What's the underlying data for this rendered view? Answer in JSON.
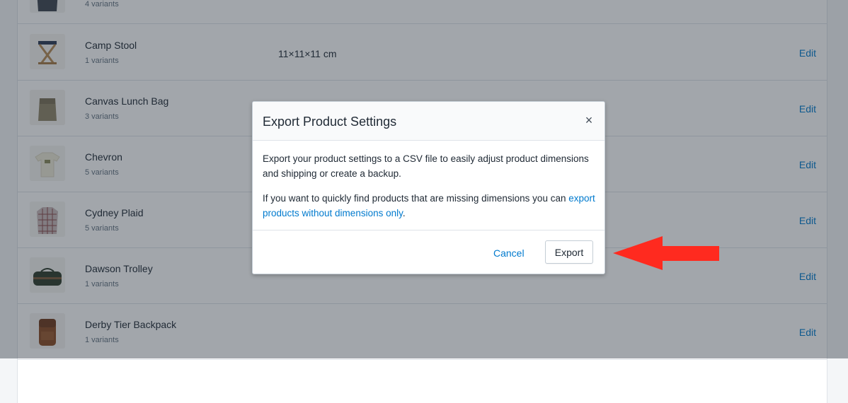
{
  "products": [
    {
      "name": "",
      "variants": "4 variants",
      "dimensions": "",
      "edit_label": "",
      "icon": "jacket-icon"
    },
    {
      "name": "Camp Stool",
      "variants": "1 variants",
      "dimensions": "11×11×11 cm",
      "edit_label": "Edit",
      "icon": "stool-icon"
    },
    {
      "name": "Canvas Lunch Bag",
      "variants": "3 variants",
      "dimensions": "",
      "edit_label": "Edit",
      "icon": "bag-icon"
    },
    {
      "name": "Chevron",
      "variants": "5 variants",
      "dimensions": "",
      "edit_label": "Edit",
      "icon": "tshirt-icon"
    },
    {
      "name": "Cydney Plaid",
      "variants": "5 variants",
      "dimensions": "",
      "edit_label": "Edit",
      "icon": "plaid-shirt-icon"
    },
    {
      "name": "Dawson Trolley",
      "variants": "1 variants",
      "dimensions": "",
      "edit_label": "Edit",
      "icon": "duffel-bag-icon"
    },
    {
      "name": "Derby Tier Backpack",
      "variants": "1 variants",
      "dimensions": "",
      "edit_label": "Edit",
      "icon": "backpack-icon"
    }
  ],
  "modal": {
    "title": "Export Product Settings",
    "close_icon": "×",
    "paragraph1": "Export your product settings to a CSV file to easily adjust product dimensions and shipping or create a backup.",
    "paragraph2_prefix": "If you want to quickly find products that are missing dimensions you can ",
    "paragraph2_link": "export products without dimensions only",
    "paragraph2_suffix": ".",
    "cancel_label": "Cancel",
    "export_label": "Export"
  },
  "colors": {
    "link": "#007ace",
    "annotation_arrow": "#ff2a1f",
    "overlay": "rgba(33,43,54,0.42)"
  }
}
